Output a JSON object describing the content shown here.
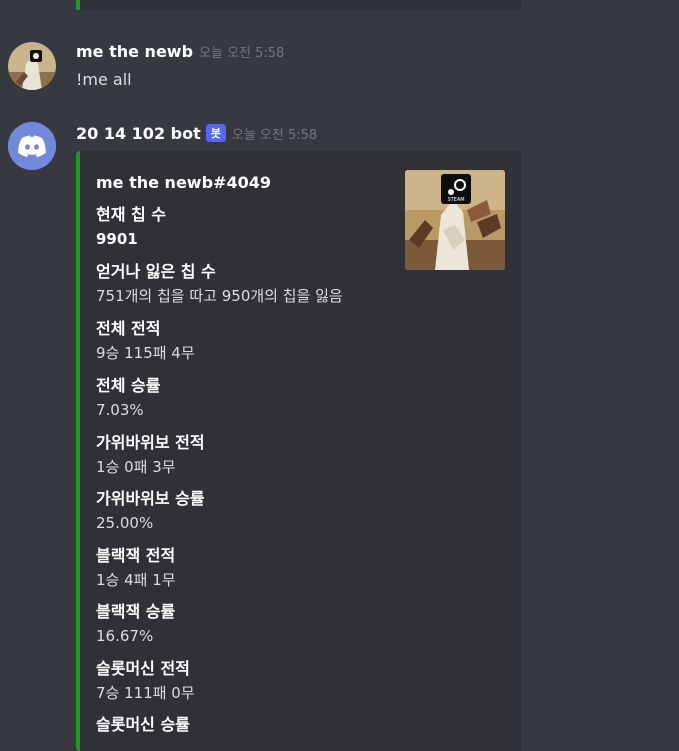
{
  "colors": {
    "background": "#36393f",
    "embed_bg": "#2f3136",
    "embed_accent": "#1f9b1f",
    "bot_tag": "#5865f2",
    "discord_blurple": "#7289da"
  },
  "message1": {
    "username": "me the newb",
    "timestamp": "오늘 오전 5:58",
    "content": "!me all",
    "avatar_icon": "user-avatar-steam-statue"
  },
  "message2": {
    "username": "20 14 102 bot",
    "bot_tag": "봇",
    "timestamp": "오늘 오전 5:58",
    "avatar_icon": "discord-logo-icon",
    "embed": {
      "author": "me the newb#4049",
      "thumbnail_icon": "steam-statue-thumbnail",
      "fields": [
        {
          "name": "현재 칩 수",
          "value": "9901"
        },
        {
          "name": "얻거나 잃은 칩 수",
          "value": "751개의 칩을 따고 950개의 칩을 잃음"
        },
        {
          "name": "전체 전적",
          "value": "9승 115패 4무"
        },
        {
          "name": "전체 승률",
          "value": "7.03%"
        },
        {
          "name": "가위바위보 전적",
          "value": "1승 0패 3무"
        },
        {
          "name": "가위바위보 승률",
          "value": "25.00%"
        },
        {
          "name": "블랙잭 전적",
          "value": "1승 4패 1무"
        },
        {
          "name": "블랙잭 승률",
          "value": "16.67%"
        },
        {
          "name": "슬롯머신 전적",
          "value": "7승 111패 0무"
        },
        {
          "name": "슬롯머신 승률",
          "value": ""
        }
      ]
    }
  }
}
